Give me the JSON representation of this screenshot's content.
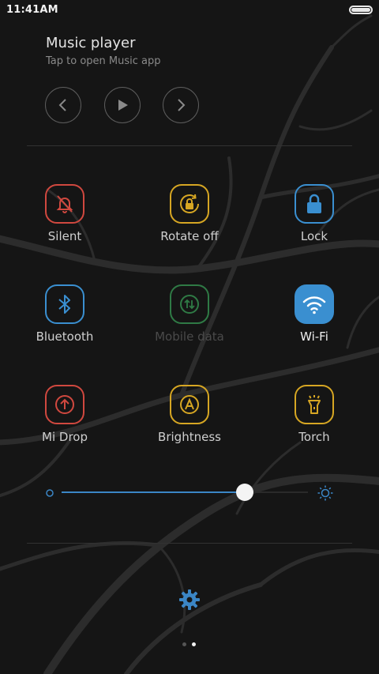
{
  "status_bar": {
    "time": "11:41AM"
  },
  "music": {
    "title": "Music player",
    "subtitle": "Tap to open Music app",
    "controls": [
      "previous-icon",
      "play-icon",
      "next-icon"
    ]
  },
  "toggles": [
    {
      "label": "Silent",
      "icon": "bell-off-icon",
      "color": "#d0483f",
      "state": "off"
    },
    {
      "label": "Rotate off",
      "icon": "rotate-lock-icon",
      "color": "#d6a623",
      "state": "off"
    },
    {
      "label": "Lock",
      "icon": "padlock-icon",
      "color": "#3a8fd0",
      "state": "off"
    },
    {
      "label": "Bluetooth",
      "icon": "bluetooth-icon",
      "color": "#3a8fd0",
      "state": "off"
    },
    {
      "label": "Mobile data",
      "icon": "mobile-data-icon",
      "color": "#2f7a45",
      "state": "disabled"
    },
    {
      "label": "Wi-Fi",
      "icon": "wifi-icon",
      "color": "#3a8fd0",
      "state": "on"
    },
    {
      "label": "Mi Drop",
      "icon": "mi-drop-icon",
      "color": "#d0483f",
      "state": "off"
    },
    {
      "label": "Brightness",
      "icon": "auto-brightness-icon",
      "color": "#d6a623",
      "state": "off"
    },
    {
      "label": "Torch",
      "icon": "torch-icon",
      "color": "#d6a623",
      "state": "off"
    }
  ],
  "brightness": {
    "level": 0.75,
    "accent": "#3b86c6",
    "min_icon": "brightness-low-icon",
    "max_icon": "brightness-high-icon"
  },
  "settings_icon": "gear-icon",
  "pager": {
    "pages": 2,
    "current": 2
  }
}
